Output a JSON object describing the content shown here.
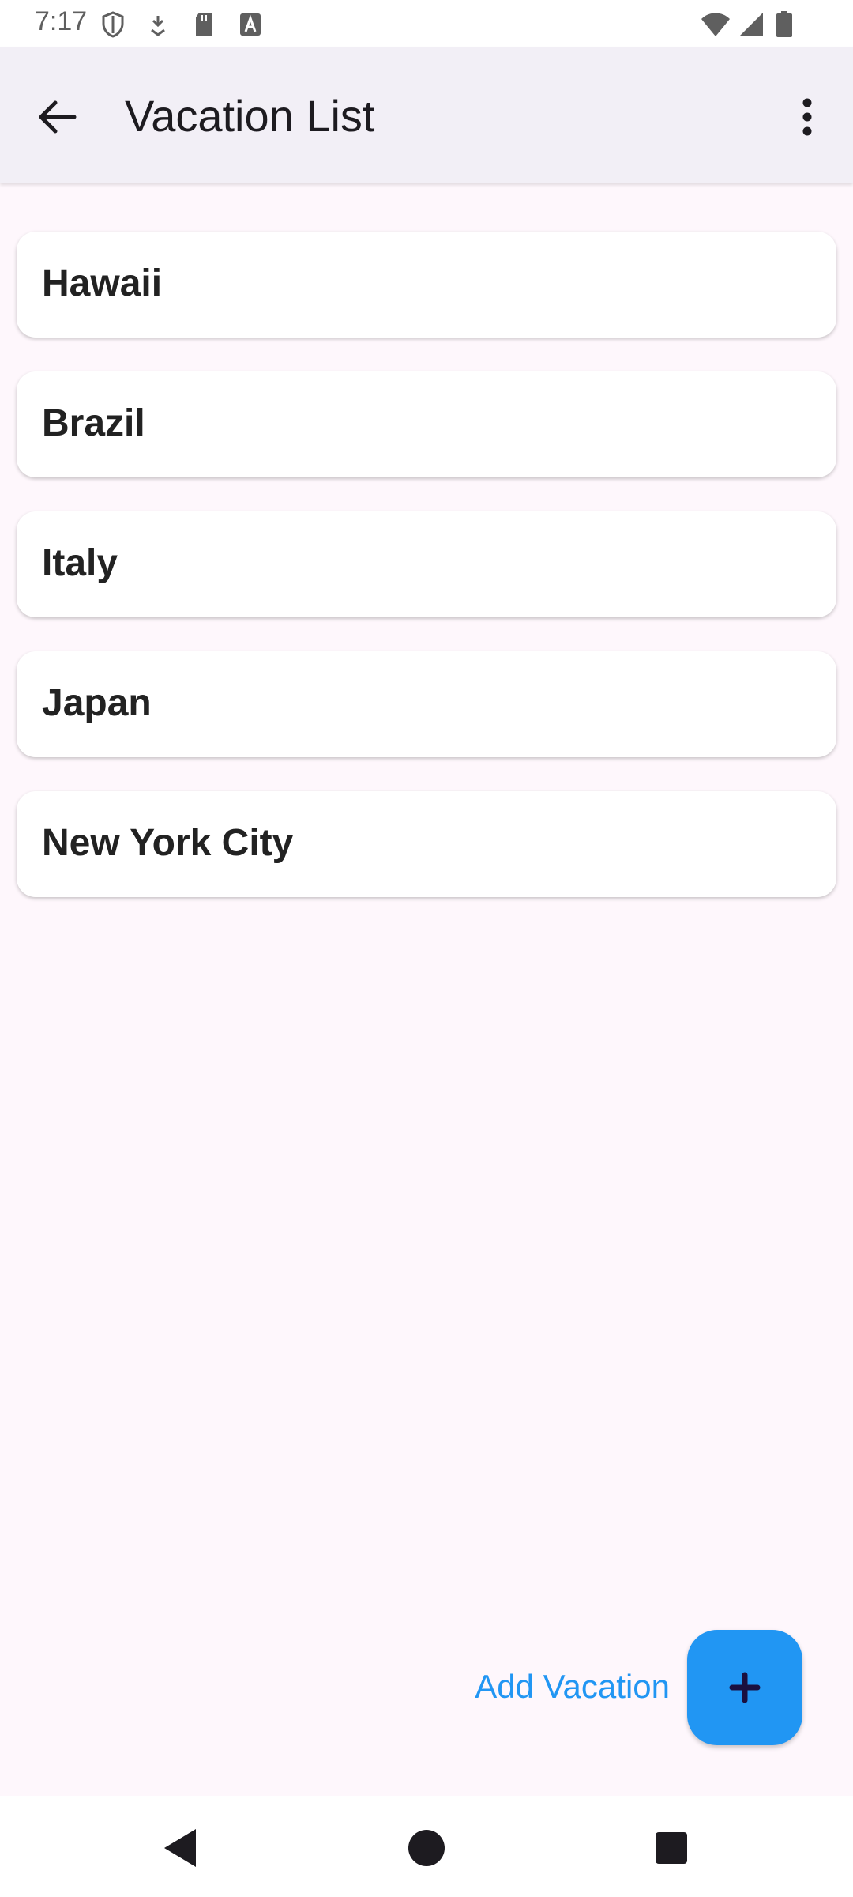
{
  "status_bar": {
    "time": "7:17",
    "left_icons": [
      "shield-icon",
      "download-icon",
      "sd-card-icon",
      "font-a-icon"
    ],
    "right_icons": [
      "wifi-icon",
      "signal-icon",
      "battery-icon"
    ]
  },
  "app_bar": {
    "title": "Vacation List",
    "back_icon": "arrow-back-icon",
    "menu_icon": "more-vert-icon"
  },
  "vacations": [
    {
      "label": "Hawaii"
    },
    {
      "label": "Brazil"
    },
    {
      "label": "Italy"
    },
    {
      "label": "Japan"
    },
    {
      "label": "New York City"
    }
  ],
  "fab": {
    "label": "Add Vacation",
    "icon": "plus-icon",
    "accent_color": "#2196F3"
  },
  "nav_bar": {
    "icons": [
      "nav-back-icon",
      "nav-home-icon",
      "nav-recents-icon"
    ]
  },
  "colors": {
    "background": "#FEF7FC",
    "app_bar": "#F2EFF6",
    "card": "#FFFFFF",
    "text": "#222222"
  }
}
